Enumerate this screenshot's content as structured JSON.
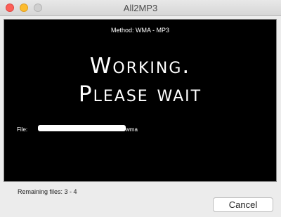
{
  "window": {
    "title": "All2MP3"
  },
  "screen": {
    "method": "Method: WMA - MP3",
    "working_line1": "Working.",
    "working_line2": "Please wait",
    "file_label": "File:",
    "file_suffix": "wma"
  },
  "footer": {
    "remaining": "Remaining files: 3 - 4",
    "cancel_label": "Cancel"
  },
  "colors": {
    "screen_bg": "#000000",
    "window_bg": "#ececec",
    "close": "#fc5f57",
    "minimize": "#fdbc2e",
    "zoom": "#cfcfcf"
  }
}
